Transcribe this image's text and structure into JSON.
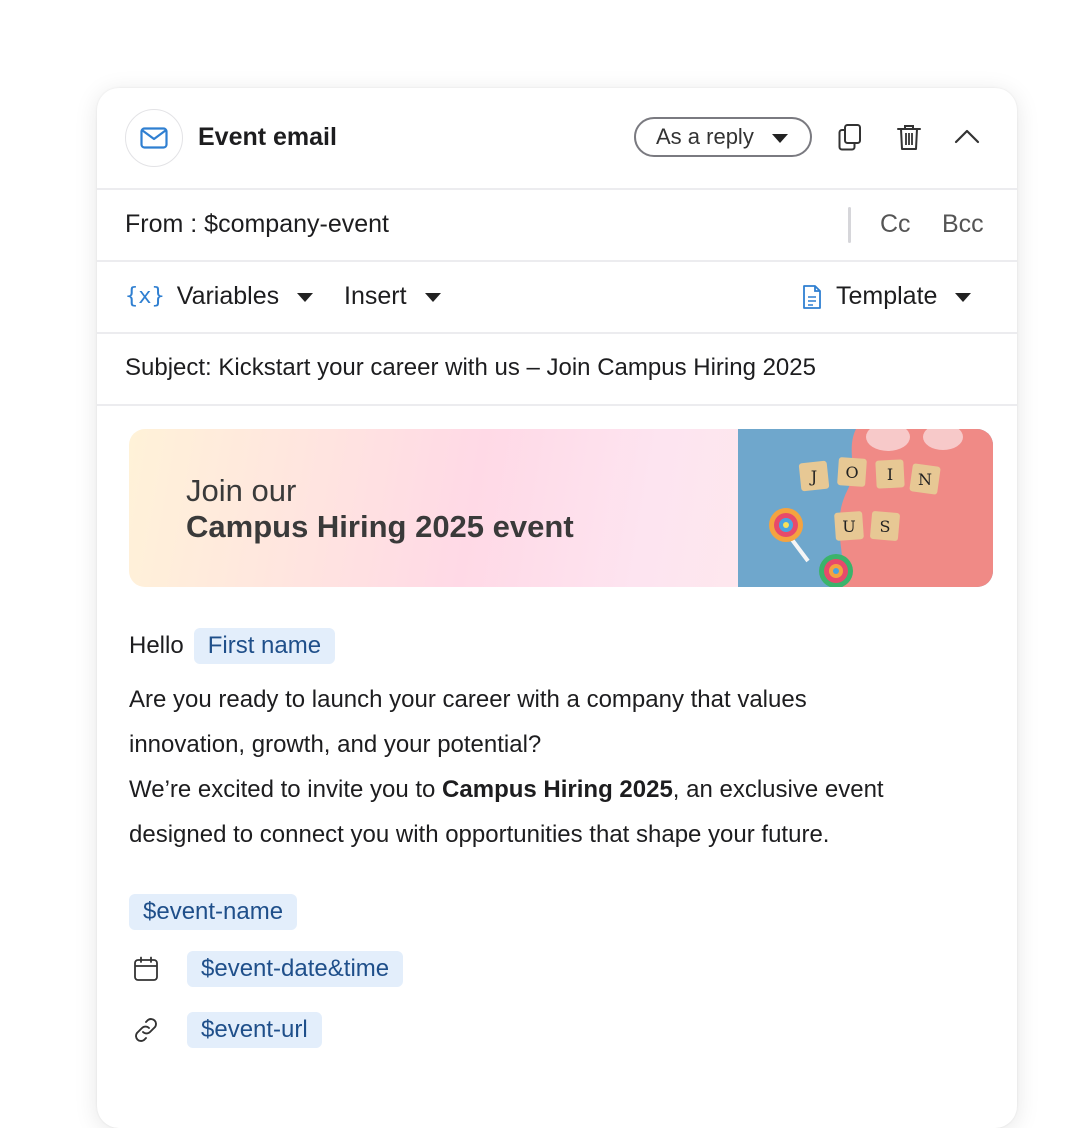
{
  "header": {
    "title": "Event email",
    "reply_mode": "As a reply"
  },
  "from": {
    "label": "From : $company-event",
    "cc": "Cc",
    "bcc": "Bcc"
  },
  "toolbar": {
    "variables": "Variables",
    "insert": "Insert",
    "template": "Template"
  },
  "subject": "Subject: Kickstart your career with us – Join Campus Hiring 2025",
  "banner": {
    "line1": "Join our",
    "line2": "Campus Hiring 2025 event",
    "tiles": [
      "J",
      "O",
      "I",
      "N",
      "U",
      "S"
    ]
  },
  "body": {
    "greeting": "Hello",
    "first_name_chip": "First name",
    "para1_line1": "Are you ready to launch your career with a company that values",
    "para1_line2": "innovation, growth, and your potential?",
    "para2_before": "We’re excited to invite you to ",
    "para2_bold": "Campus Hiring 2025",
    "para2_after": ", an exclusive event",
    "para2_line2": "designed to connect you with opportunities that shape your future.",
    "event_name": "$event-name",
    "event_datetime": "$event-date&time",
    "event_url": "$event-url"
  },
  "colors": {
    "accent": "#2f7fd1",
    "chip_bg": "#e3eefb",
    "chip_text": "#1f4f8a"
  },
  "icons": [
    "mail-icon",
    "chevron-down-icon",
    "copy-icon",
    "trash-icon",
    "chevron-up-icon",
    "variables-icon",
    "document-icon",
    "calendar-icon",
    "link-icon"
  ]
}
